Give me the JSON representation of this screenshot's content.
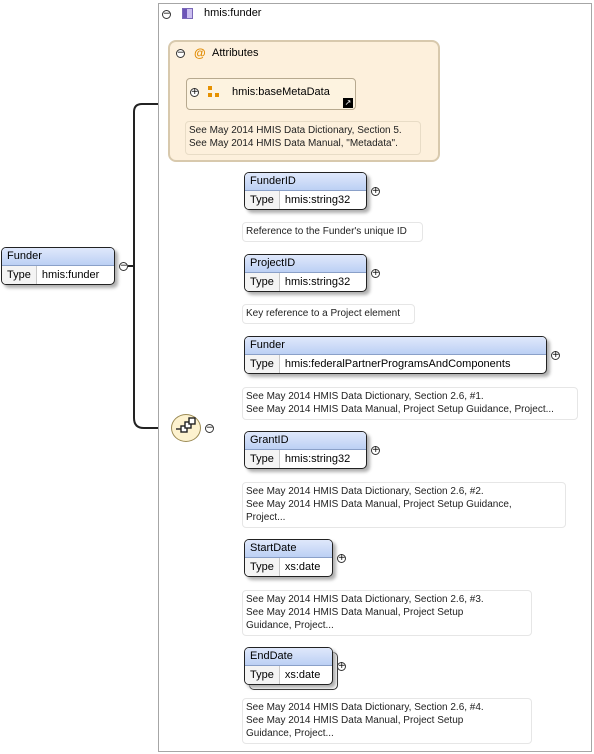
{
  "complex_type": {
    "name": "hmis:funder",
    "attributes": {
      "title": "Attributes",
      "group": {
        "name": "hmis:baseMetaData"
      },
      "documentation": [
        "See May 2014 HMIS Data Dictionary, Section 5.",
        "See May 2014 HMIS Data Manual, \"Metadata\"."
      ]
    }
  },
  "root": {
    "name": "Funder",
    "type_label": "Type",
    "type": "hmis:funder"
  },
  "sequence": [
    {
      "name": "FunderID",
      "type_label": "Type",
      "type": "hmis:string32",
      "documentation": [
        "Reference to the Funder's unique ID"
      ]
    },
    {
      "name": "ProjectID",
      "type_label": "Type",
      "type": "hmis:string32",
      "documentation": [
        "Key reference to a Project element"
      ]
    },
    {
      "name": "Funder",
      "type_label": "Type",
      "type": "hmis:federalPartnerProgramsAndComponents",
      "documentation": [
        "See May 2014 HMIS Data Dictionary, Section 2.6, #1.",
        "See May 2014 HMIS Data Manual, Project Setup Guidance, Project..."
      ]
    },
    {
      "name": "GrantID",
      "type_label": "Type",
      "type": "hmis:string32",
      "documentation": [
        "See May 2014 HMIS Data Dictionary, Section 2.6, #2.",
        "See May 2014 HMIS Data Manual, Project Setup Guidance,",
        "Project..."
      ]
    },
    {
      "name": "StartDate",
      "type_label": "Type",
      "type": "xs:date",
      "documentation": [
        "See May 2014 HMIS Data Dictionary, Section 2.6, #3.",
        "See May 2014 HMIS Data Manual, Project Setup",
        "Guidance, Project..."
      ]
    },
    {
      "name": "EndDate",
      "type_label": "Type",
      "type": "xs:date",
      "documentation": [
        "See May 2014 HMIS Data Dictionary, Section 2.6, #4.",
        "See May 2014 HMIS Data Manual, Project Setup",
        "Guidance, Project..."
      ]
    }
  ]
}
